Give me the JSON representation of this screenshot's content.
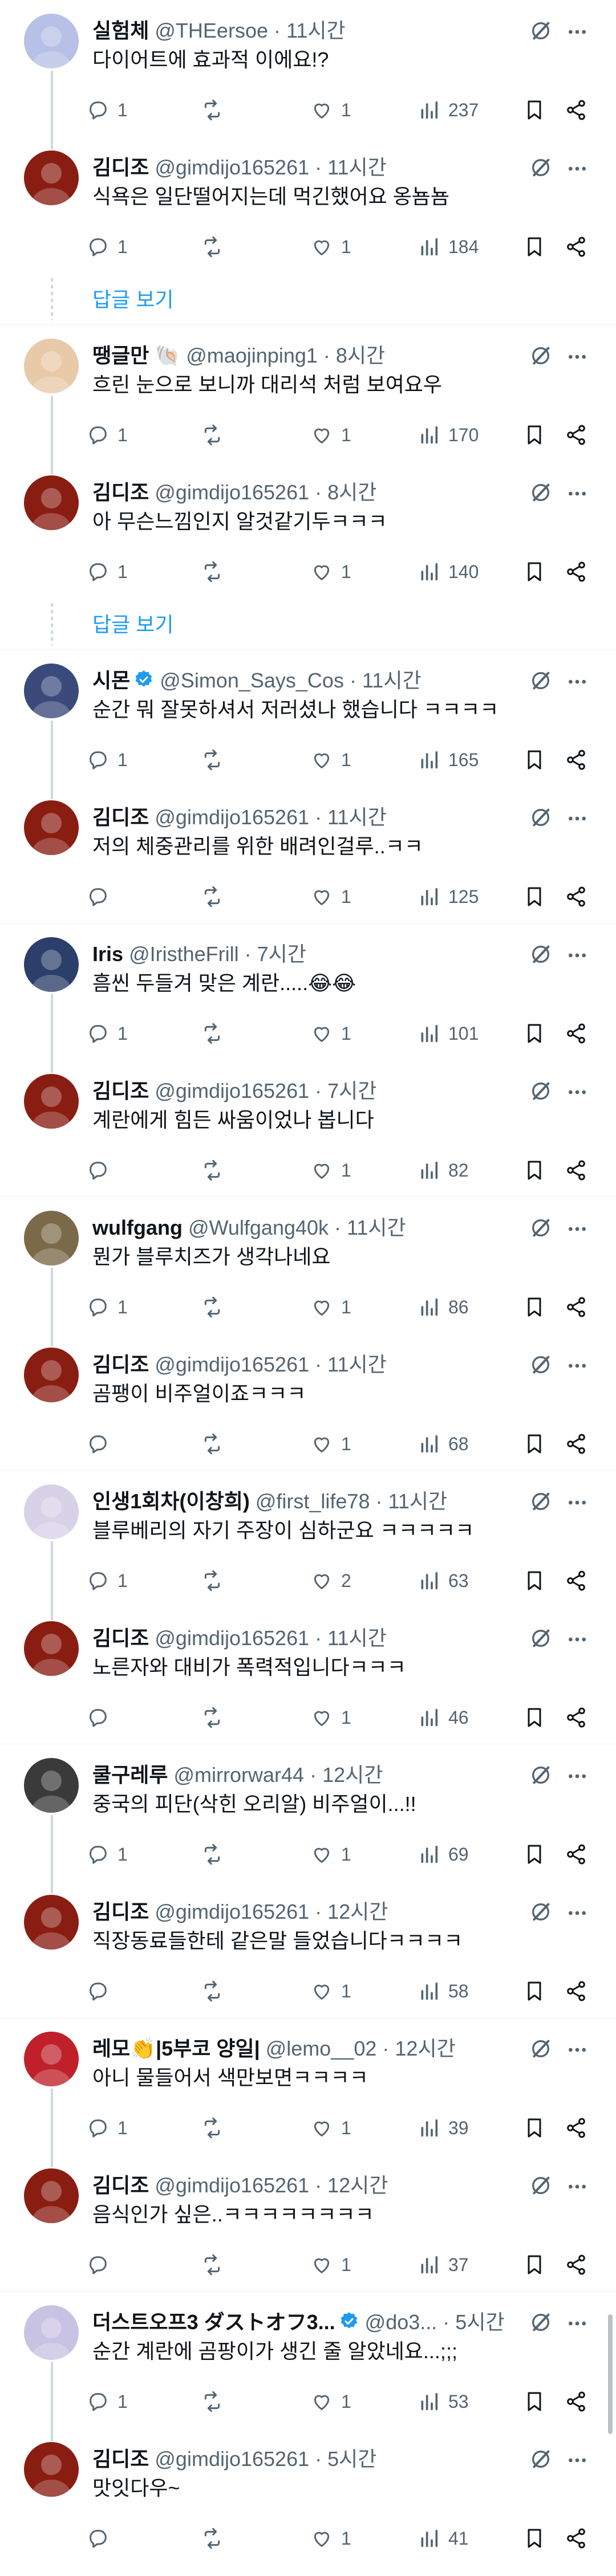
{
  "labels": {
    "more_replies": "답글 보기"
  },
  "colors": {
    "accent": "#1d9bf0",
    "muted": "#536471",
    "line": "#cfd9de",
    "text": "#0f1419"
  },
  "icons": [
    "reply-icon",
    "retweet-icon",
    "like-icon",
    "views-icon",
    "bookmark-icon",
    "share-icon",
    "grok-icon",
    "more-icon",
    "verified-icon"
  ],
  "tweets": [
    {
      "name": "실험체",
      "handle": "@THEersoe",
      "time": "11시간",
      "text": "다이어트에 효과적 이에요!?",
      "replies": "1",
      "retweets": "",
      "likes": "1",
      "views": "237",
      "avatar": "#b7c0e6"
    },
    {
      "name": "김디조",
      "handle": "@gimdijo165261",
      "time": "11시간",
      "text": "식욕은 일단떨어지는데 먹긴했어요 옹뇸뇸",
      "replies": "1",
      "retweets": "",
      "likes": "1",
      "views": "184",
      "avatar": "#8a1d12"
    },
    {
      "name": "땡글만 🐚",
      "handle": "@maojinping1",
      "time": "8시간",
      "text": "흐린 눈으로 보니까 대리석 처럼 보여요우",
      "replies": "1",
      "retweets": "",
      "likes": "1",
      "views": "170",
      "avatar": "#e8c9a8"
    },
    {
      "name": "김디조",
      "handle": "@gimdijo165261",
      "time": "8시간",
      "text": "아 무슨느낌인지 알것같기두ㅋㅋㅋ",
      "replies": "1",
      "retweets": "",
      "likes": "1",
      "views": "140",
      "avatar": "#8a1d12"
    },
    {
      "name": "시몬",
      "handle": "@Simon_Says_Cos",
      "time": "11시간",
      "text": "순간 뭐 잘못하셔서 저러셨나 했습니다 ㅋㅋㅋㅋ",
      "replies": "1",
      "retweets": "",
      "likes": "1",
      "views": "165",
      "avatar": "#3a4a7a",
      "verified": true
    },
    {
      "name": "김디조",
      "handle": "@gimdijo165261",
      "time": "11시간",
      "text": "저의 체중관리를 위한 배려인걸루..ㅋㅋ",
      "replies": "",
      "retweets": "",
      "likes": "1",
      "views": "125",
      "avatar": "#8a1d12"
    },
    {
      "name": "Iris",
      "handle": "@IristheFrill",
      "time": "7시간",
      "text": "흠씬 두들겨 맞은 계란.....😂😂",
      "replies": "1",
      "retweets": "",
      "likes": "1",
      "views": "101",
      "avatar": "#2c3f6b"
    },
    {
      "name": "김디조",
      "handle": "@gimdijo165261",
      "time": "7시간",
      "text": "계란에게 힘든 싸움이었나 봅니다",
      "replies": "",
      "retweets": "",
      "likes": "1",
      "views": "82",
      "avatar": "#8a1d12"
    },
    {
      "name": "wulfgang",
      "handle": "@Wulfgang40k",
      "time": "11시간",
      "text": "뭔가 블루치즈가 생각나네요",
      "replies": "1",
      "retweets": "",
      "likes": "1",
      "views": "86",
      "avatar": "#7a6a4a"
    },
    {
      "name": "김디조",
      "handle": "@gimdijo165261",
      "time": "11시간",
      "text": "곰팽이 비주얼이죠ㅋㅋㅋ",
      "replies": "",
      "retweets": "",
      "likes": "1",
      "views": "68",
      "avatar": "#8a1d12"
    },
    {
      "name": "인생1회차(이창희)",
      "handle": "@first_life78",
      "time": "11시간",
      "text": "블루베리의 자기 주장이 심하군요 ㅋㅋㅋㅋㅋ",
      "replies": "1",
      "retweets": "",
      "likes": "2",
      "views": "63",
      "avatar": "#d8d2e8"
    },
    {
      "name": "김디조",
      "handle": "@gimdijo165261",
      "time": "11시간",
      "text": "노른자와 대비가 폭력적입니다ㅋㅋㅋ",
      "replies": "",
      "retweets": "",
      "likes": "1",
      "views": "46",
      "avatar": "#8a1d12"
    },
    {
      "name": "쿨구레루",
      "handle": "@mirrorwar44",
      "time": "12시간",
      "text": "중국의 피단(삭힌 오리알) 비주얼이...!!",
      "replies": "1",
      "retweets": "",
      "likes": "1",
      "views": "69",
      "avatar": "#3a3a3a"
    },
    {
      "name": "김디조",
      "handle": "@gimdijo165261",
      "time": "12시간",
      "text": "직장동료들한테 같은말 들었습니다ㅋㅋㅋㅋ",
      "replies": "",
      "retweets": "",
      "likes": "1",
      "views": "58",
      "avatar": "#8a1d12"
    },
    {
      "name": "레모👏|5부코 양일|",
      "handle": "@lemo__02",
      "time": "12시간",
      "text": "아니 물들어서 색만보면ㅋㅋㅋㅋ",
      "replies": "1",
      "retweets": "",
      "likes": "1",
      "views": "39",
      "avatar": "#c0202a"
    },
    {
      "name": "김디조",
      "handle": "@gimdijo165261",
      "time": "12시간",
      "text": "음식인가 싶은..ㅋㅋㅋㅋㅋㅋㅋㅋ",
      "replies": "",
      "retweets": "",
      "likes": "1",
      "views": "37",
      "avatar": "#8a1d12"
    },
    {
      "name": "더스트오프3 ダストオフ3...",
      "handle": "@do3...",
      "time": "5시간",
      "text": "순간 계란에 곰팡이가 생긴 줄 알았네요...;;;",
      "replies": "1",
      "retweets": "",
      "likes": "1",
      "views": "53",
      "avatar": "#c9c3e3",
      "verified": true
    },
    {
      "name": "김디조",
      "handle": "@gimdijo165261",
      "time": "5시간",
      "text": "맛잇다우~",
      "replies": "",
      "retweets": "",
      "likes": "1",
      "views": "41",
      "avatar": "#8a1d12"
    }
  ]
}
